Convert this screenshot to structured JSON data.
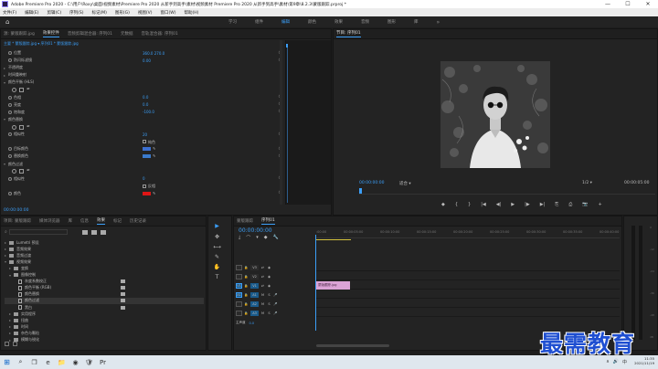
{
  "window": {
    "title": "Adobe Premiere Pro 2020 - C:\\用户\\Roxy\\桌面\\视频素材\\Premiere Pro 2020 从新手到高手\\素材\\视频素材 Premiere Pro 2020 从新手到高手\\素材\\第9章\\8.2.3\\蒙版跟踪.prproj *",
    "controls": [
      "—",
      "☐",
      "✕"
    ]
  },
  "menu": [
    "文件(F)",
    "编辑(E)",
    "剪辑(C)",
    "序列(S)",
    "标记(M)",
    "图形(G)",
    "视图(V)",
    "窗口(W)",
    "帮助(H)"
  ],
  "workspaces": {
    "items": [
      "学习",
      "组件",
      "编辑",
      "颜色",
      "效果",
      "音频",
      "图形",
      "库"
    ],
    "active": "编辑",
    "more": "»"
  },
  "effects_panel": {
    "tabs": [
      "源: 蒙版跟踪.jpg",
      "效果控件",
      "音频剪辑混合器: 序列01",
      "元数据",
      "音轨混合器: 序列01"
    ],
    "active_tab": "效果控件",
    "header": "主要 * 蒙版跟踪.jpg  ▾  序列01 * 蒙版跟踪.jpg",
    "rows": [
      {
        "tri": "",
        "label": "位置",
        "value": "360.0  270.0"
      },
      {
        "tri": "",
        "label": "防闪烁滤镜",
        "value": "0.00"
      },
      {
        "tri": "▸",
        "label": "不透明度",
        "value": ""
      },
      {
        "tri": "▸",
        "label": "时间重映射",
        "value": ""
      },
      {
        "tri": "▾",
        "label": "颜色平衡 (HLS)",
        "value": ""
      },
      {
        "tri": "",
        "label": "",
        "value": ""
      },
      {
        "tri": "",
        "label": "色相",
        "value": "0.0"
      },
      {
        "tri": "",
        "label": "亮度",
        "value": "0.0"
      },
      {
        "tri": "",
        "label": "饱和度",
        "value": "-100.0"
      },
      {
        "tri": "▾",
        "label": "颜色替换",
        "value": ""
      },
      {
        "tri": "",
        "label": "",
        "value": ""
      },
      {
        "tri": "",
        "label": "相似性",
        "value": "20"
      },
      {
        "tri": "",
        "label": "",
        "value": ""
      },
      {
        "tri": "",
        "label": "目标颜色",
        "value": ""
      },
      {
        "tri": "",
        "label": "替换颜色",
        "value": ""
      },
      {
        "tri": "▾",
        "label": "颜色过滤",
        "value": ""
      },
      {
        "tri": "",
        "label": "",
        "value": ""
      },
      {
        "tri": "",
        "label": "相似性",
        "value": "0"
      },
      {
        "tri": "",
        "label": "",
        "value": ""
      },
      {
        "tri": "",
        "label": "颜色",
        "value": ""
      }
    ],
    "checkbox_labels": {
      "solid": "纯色",
      "reverse": "反相"
    },
    "colors": {
      "target": "#3b6fd0",
      "replace": "#3a7acc",
      "filter": "#e01515"
    },
    "current_time": "00:00:00:00",
    "keyframe_icon": "⊙"
  },
  "program_monitor": {
    "title": "节目: 序列01",
    "timecode": "00:00:00:00",
    "fit": "适合",
    "quality": "1/2",
    "duration": "00:00:05:00",
    "controls": [
      "◆",
      "{",
      "}",
      "|◀",
      "◀|",
      "▶",
      "|▶",
      "▶|",
      "⎘",
      "⎙",
      "📷",
      "+"
    ]
  },
  "project_panel": {
    "tabs": [
      "项目: 蒙版跟踪",
      "媒体浏览器",
      "库",
      "信息",
      "效果",
      "标记",
      "历史记录"
    ],
    "active_tab": "效果",
    "tree": [
      {
        "indent": 0,
        "tri": "▸",
        "kind": "folder",
        "label": "Lumetri 预设"
      },
      {
        "indent": 0,
        "tri": "▸",
        "kind": "folder",
        "label": "音频效果"
      },
      {
        "indent": 0,
        "tri": "▸",
        "kind": "folder",
        "label": "音频过渡"
      },
      {
        "indent": 0,
        "tri": "▾",
        "kind": "folder",
        "label": "视频效果"
      },
      {
        "indent": 1,
        "tri": "▸",
        "kind": "folder",
        "label": "变换"
      },
      {
        "indent": 1,
        "tri": "▾",
        "kind": "folder",
        "label": "图像控制"
      },
      {
        "indent": 2,
        "tri": "",
        "kind": "file",
        "label": "灰度系数校正",
        "badge": true
      },
      {
        "indent": 2,
        "tri": "",
        "kind": "file",
        "label": "颜色平衡 (RGB)",
        "badge": true
      },
      {
        "indent": 2,
        "tri": "",
        "kind": "file",
        "label": "颜色替换",
        "badge": true
      },
      {
        "indent": 2,
        "tri": "",
        "kind": "file",
        "label": "颜色过滤",
        "badge": true,
        "selected": true
      },
      {
        "indent": 2,
        "tri": "",
        "kind": "file",
        "label": "黑白",
        "badge": true
      },
      {
        "indent": 1,
        "tri": "▸",
        "kind": "folder",
        "label": "实用程序"
      },
      {
        "indent": 1,
        "tri": "▸",
        "kind": "folder",
        "label": "扭曲"
      },
      {
        "indent": 1,
        "tri": "▸",
        "kind": "folder",
        "label": "时间"
      },
      {
        "indent": 1,
        "tri": "▸",
        "kind": "folder",
        "label": "杂色与颗粒"
      },
      {
        "indent": 1,
        "tri": "▸",
        "kind": "folder",
        "label": "模糊与锐化"
      }
    ]
  },
  "tools": [
    "▶",
    "✥",
    "⟷",
    "✎",
    "✋",
    "T"
  ],
  "timeline": {
    "tabs": [
      "蒙版跟踪",
      "序列01"
    ],
    "active_tab": "序列01",
    "timecode": "00:00:00:00",
    "toolbar_icons": [
      "⤓",
      "⌒",
      "▾",
      "◆",
      "🔧"
    ],
    "ruler": [
      ":00:00",
      "00:00:05:00",
      "00:00:10:00",
      "00:00:15:00",
      "00:00:20:00",
      "00:00:25:00",
      "00:00:30:00",
      "00:00:35:00",
      "00:00:40:00"
    ],
    "tracks": [
      {
        "target": "",
        "name": "V3",
        "on": false,
        "audio": false
      },
      {
        "target": "",
        "name": "V2",
        "on": false,
        "audio": false
      },
      {
        "target": "V1",
        "name": "V1",
        "on": true,
        "audio": false
      },
      {
        "target": "A1",
        "name": "A1",
        "on": true,
        "audio": true
      },
      {
        "target": "",
        "name": "A2",
        "on": true,
        "audio": true
      },
      {
        "target": "",
        "name": "A3",
        "on": true,
        "audio": true
      }
    ],
    "clip": {
      "label": "蒙版跟踪.jpg",
      "color": "#dba3d6"
    },
    "master": {
      "label": "主声道",
      "value": "0.0"
    }
  },
  "meters": {
    "scale": [
      "0",
      "-12",
      "-24",
      "-36",
      "-48",
      "dB"
    ]
  },
  "watermark": "最需教育",
  "taskbar": {
    "icons": [
      "⊞",
      "⌕",
      "❐",
      "e",
      "📁",
      "◉",
      "🛡",
      "Pr"
    ],
    "tray_icons": [
      "∧",
      "🔊",
      "中"
    ],
    "time": "11:35",
    "date": "2021/11/19"
  }
}
